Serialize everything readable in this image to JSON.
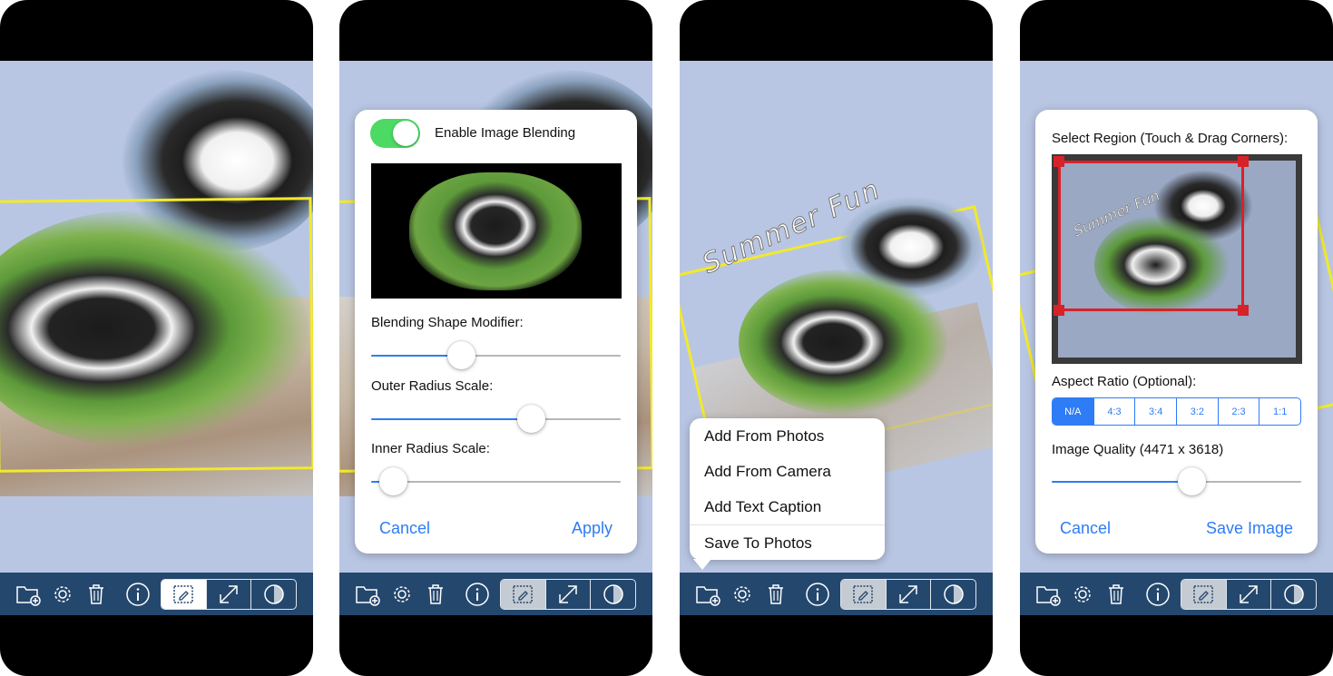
{
  "colors": {
    "accent": "#2e7cf6",
    "toolbar": "#24476d",
    "canvas": "#b9c6e3",
    "frame_yellow": "#f2ea2a",
    "crop_red": "#d8222a",
    "switch_on": "#4cd964"
  },
  "toolbar": {
    "icons": [
      "add-folder-icon",
      "gear-icon",
      "trash-icon",
      "info-icon",
      "edit-frame-icon",
      "resize-arrow-icon",
      "blend-circle-icon"
    ]
  },
  "screen2": {
    "blend_toggle_label": "Enable Image Blending",
    "blend_enabled": true,
    "shape_modifier_label": "Blending Shape Modifier:",
    "shape_modifier_value": 0.36,
    "outer_radius_label": "Outer Radius Scale:",
    "outer_radius_value": 0.64,
    "inner_radius_label": "Inner Radius Scale:",
    "inner_radius_value": 0.09,
    "cancel_label": "Cancel",
    "apply_label": "Apply"
  },
  "screen3": {
    "caption_text": "Summer Fun",
    "menu_items": [
      "Add From Photos",
      "Add From Camera",
      "Add Text Caption",
      "Save To Photos"
    ]
  },
  "screen4": {
    "region_label": "Select Region (Touch & Drag Corners):",
    "aspect_label": "Aspect Ratio (Optional):",
    "aspect_options": [
      "N/A",
      "4:3",
      "3:4",
      "3:2",
      "2:3",
      "1:1"
    ],
    "aspect_selected": "N/A",
    "quality_label": "Image Quality (4471 x 3618)",
    "quality_value": 0.56,
    "cancel_label": "Cancel",
    "save_label": "Save Image",
    "caption_text": "Summer Fun"
  }
}
